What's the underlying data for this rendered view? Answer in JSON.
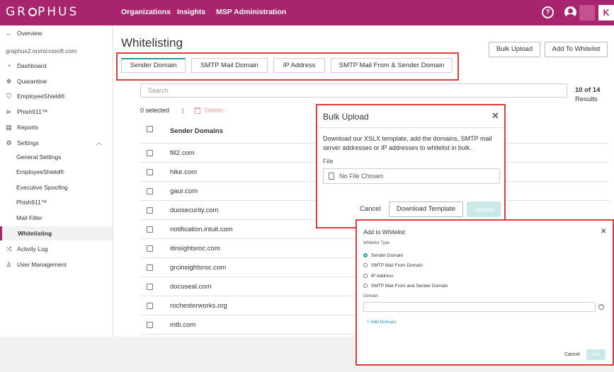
{
  "topbar": {
    "logo_pre": "GR",
    "logo_post": "PHUS",
    "nav": [
      "Organizations",
      "Insights",
      "MSP Administration"
    ],
    "help": "?",
    "brand_tile": "K"
  },
  "sidebar": {
    "overview": "Overview",
    "tenant": "graphus2.onmicrosoft.com",
    "items": [
      {
        "icon": "dashboard-icon",
        "label": "Dashboard"
      },
      {
        "icon": "quarantine-icon",
        "label": "Quarantine"
      },
      {
        "icon": "shield-icon",
        "label": "EmployeeShield®"
      },
      {
        "icon": "phish-icon",
        "label": "Phish911™"
      },
      {
        "icon": "reports-icon",
        "label": "Reports"
      },
      {
        "icon": "gear-icon",
        "label": "Settings"
      }
    ],
    "settings_sub": [
      "General Settings",
      "EmployeeShield®",
      "Executive Spoofing",
      "Phish911™",
      "Mail Filter",
      "Whitelisting"
    ],
    "bottom_items": [
      {
        "icon": "activity-icon",
        "label": "Activity Log"
      },
      {
        "icon": "user-icon",
        "label": "User Management"
      }
    ]
  },
  "main": {
    "title": "Whitelisting",
    "bulk_upload_btn": "Bulk Upload",
    "add_to_whitelist_btn": "Add To Whitelist",
    "tabs": [
      "Sender Domain",
      "SMTP Mail Domain",
      "IP Address",
      "SMTP Mail From & Sender Domain"
    ],
    "search_placeholder": "Search",
    "count": "10 of 14",
    "count_label": "Results",
    "selected": "0 selected",
    "separator": "|",
    "delete_label": "Delete",
    "column_header": "Sender Domains",
    "rows": [
      "fill2.com",
      "hike.com",
      "gaur.com",
      "duosecurity.com",
      "notification.intuit.com",
      "itinsightsroc.com",
      "grcinsightsroc.com",
      "docuseal.com",
      "rochesterworks.org",
      "mtb.com"
    ]
  },
  "bulk_modal": {
    "title": "Bulk Upload",
    "close": "✕",
    "description": "Download our XSLX template, add the domains, SMTP mail server addresses or IP addresses to whitelist in bulk.",
    "file_label": "File",
    "file_value": "No File Chosen",
    "cancel": "Cancel",
    "download_template": "Download Template",
    "upload": "Upload"
  },
  "add_modal": {
    "title": "Add to Whitelist",
    "close": "✕",
    "type_label": "Whitelist Type",
    "options": [
      "Sender Domain",
      "SMTP Mail From Domain",
      "IP Address",
      "SMTP Mail From and Sender Domain"
    ],
    "selected_option": 0,
    "domain_label": "Domain",
    "add_domain": "+ Add Domain",
    "cancel": "Cancel",
    "add": "Add"
  },
  "colors": {
    "brand": "#a8246e",
    "accent": "#1aa6a0",
    "highlight": "#e33b3b"
  }
}
